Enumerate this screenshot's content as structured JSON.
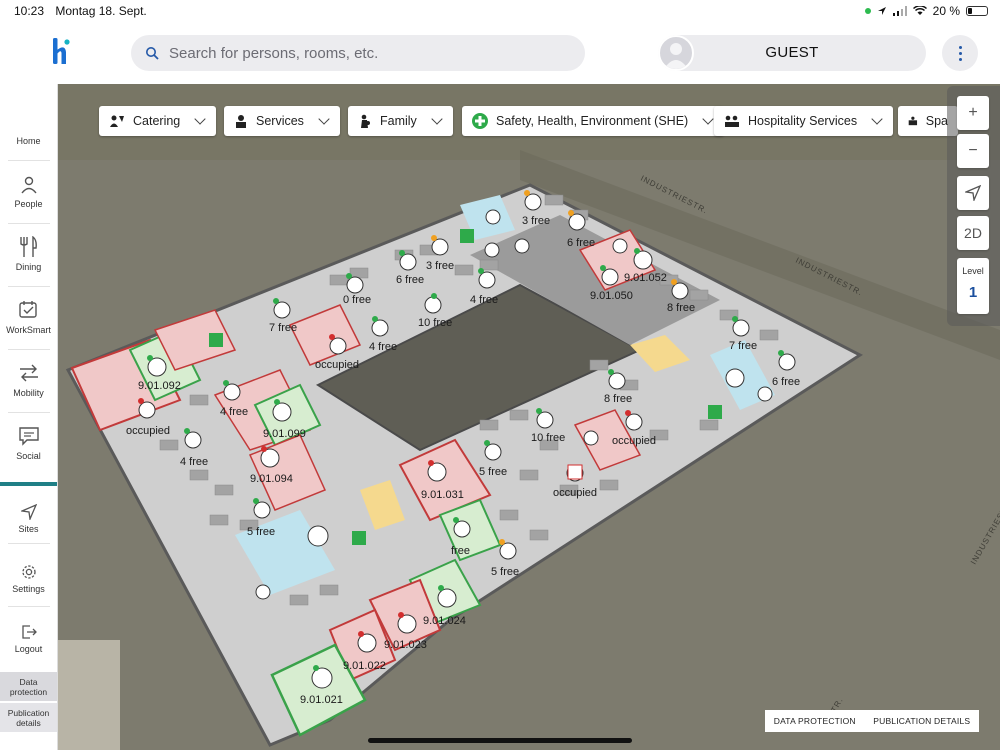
{
  "status_bar": {
    "time": "10:23",
    "date": "Montag 18. Sept.",
    "battery": "20 %"
  },
  "header": {
    "search_placeholder": "Search for persons, rooms, etc.",
    "user_name": "GUEST"
  },
  "sidebar": {
    "items": [
      {
        "label": "Home",
        "icon": "home-icon"
      },
      {
        "label": "People",
        "icon": "people-icon"
      },
      {
        "label": "Dining",
        "icon": "dining-icon"
      },
      {
        "label": "WorkSmart",
        "icon": "worksmart-icon"
      },
      {
        "label": "Mobility",
        "icon": "mobility-icon"
      },
      {
        "label": "Social",
        "icon": "social-icon"
      },
      {
        "label": "Sites",
        "icon": "sites-icon"
      },
      {
        "label": "Settings",
        "icon": "settings-icon"
      },
      {
        "label": "Logout",
        "icon": "logout-icon"
      }
    ],
    "footer": {
      "data_protection": "Data protection",
      "publication_details": "Publication details"
    }
  },
  "filters": [
    {
      "label": "Catering"
    },
    {
      "label": "Services"
    },
    {
      "label": "Family"
    },
    {
      "label": "Safety, Health, Environment (SHE)"
    },
    {
      "label": "Hospitality Services"
    },
    {
      "label": "Spa"
    }
  ],
  "map_controls": {
    "zoom_in": "+",
    "zoom_out": "−",
    "view_2d": "2D",
    "level_label": "Level",
    "level_value": "1"
  },
  "map": {
    "streets": [
      "INDUSTRIESTR.",
      "INDUSTRIESTR.",
      "INDUSTRIESTR.",
      "ESTR."
    ],
    "labels": [
      {
        "text": "3 free"
      },
      {
        "text": "6 free"
      },
      {
        "text": "3 free"
      },
      {
        "text": "6 free"
      },
      {
        "text": "9.01.052"
      },
      {
        "text": "9.01.050"
      },
      {
        "text": "8 free"
      },
      {
        "text": "0 free"
      },
      {
        "text": "4 free"
      },
      {
        "text": "10 free"
      },
      {
        "text": "7 free"
      },
      {
        "text": "4 free"
      },
      {
        "text": "occupied"
      },
      {
        "text": "7 free"
      },
      {
        "text": "6 free"
      },
      {
        "text": "9.01.092"
      },
      {
        "text": "4 free"
      },
      {
        "text": "occupied"
      },
      {
        "text": "9.01.099"
      },
      {
        "text": "4 free"
      },
      {
        "text": "8 free"
      },
      {
        "text": "10 free"
      },
      {
        "text": "occupied"
      },
      {
        "text": "9.01.094"
      },
      {
        "text": "5 free"
      },
      {
        "text": "9.01.031"
      },
      {
        "text": "occupied"
      },
      {
        "text": "5 free"
      },
      {
        "text": "free"
      },
      {
        "text": "5 free"
      },
      {
        "text": "9.01.024"
      },
      {
        "text": "9.01.023"
      },
      {
        "text": "9.01.022"
      },
      {
        "text": "9.01.021"
      }
    ]
  },
  "footer_links": {
    "data_protection": "DATA PROTECTION",
    "publication_details": "PUBLICATION DETAILS"
  },
  "colors": {
    "accent": "#1f7f86",
    "logo_blue": "#1b6fd1",
    "free_green": "#3aa24a",
    "occupied_red": "#d33a3a"
  }
}
